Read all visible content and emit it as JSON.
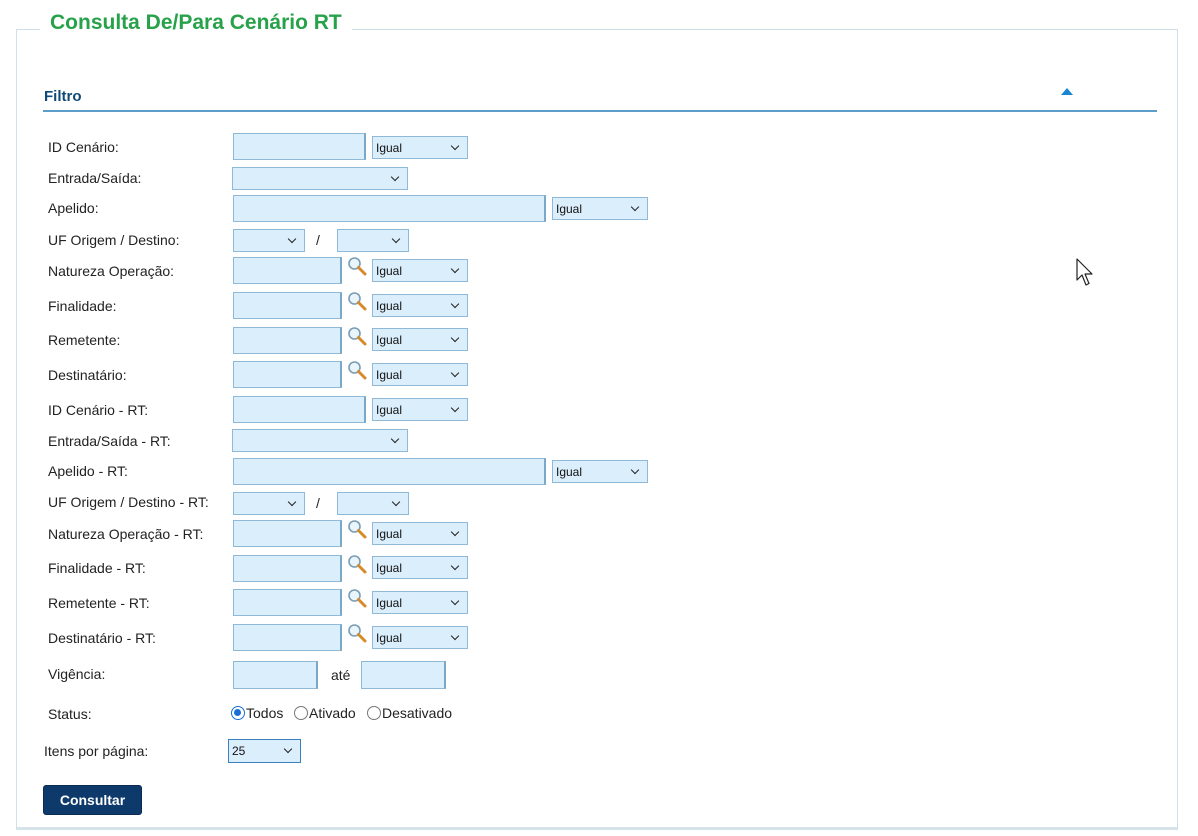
{
  "page": {
    "title": "Consulta De/Para Cenário RT"
  },
  "filter": {
    "title": "Filtro"
  },
  "labels": {
    "id_cenario": "ID Cenário:",
    "entrada_saida": "Entrada/Saída:",
    "apelido": "Apelido:",
    "uf": "UF Origem / Destino:",
    "natureza": "Natureza Operação:",
    "finalidade": "Finalidade:",
    "remetente": "Remetente:",
    "destinatario": "Destinatário:",
    "id_cenario_rt": "ID Cenário - RT:",
    "entrada_saida_rt": "Entrada/Saída - RT:",
    "apelido_rt": "Apelido - RT:",
    "uf_rt": "UF Origem / Destino - RT:",
    "natureza_rt": "Natureza Operação - RT:",
    "finalidade_rt": "Finalidade - RT:",
    "remetente_rt": "Remetente - RT:",
    "destinatario_rt": "Destinatário - RT:",
    "vigencia": "Vigência:",
    "status": "Status:",
    "itens": "Itens por página:"
  },
  "operator": "Igual",
  "uf_separator": "/",
  "vigencia_ate": "até",
  "status_options": [
    "Todos",
    "Ativado",
    "Desativado"
  ],
  "status_selected": "Todos",
  "itens_por_pagina": "25",
  "consultar_label": "Consultar",
  "icons": {
    "lookup": "magnifier-icon",
    "collapse": "caret-up-icon",
    "cursor": "mouse-cursor-icon"
  },
  "colors": {
    "title": "#27a24a",
    "section": "#0f4a78",
    "button": "#0e3a6b",
    "input_bg": "#dbeefc"
  }
}
